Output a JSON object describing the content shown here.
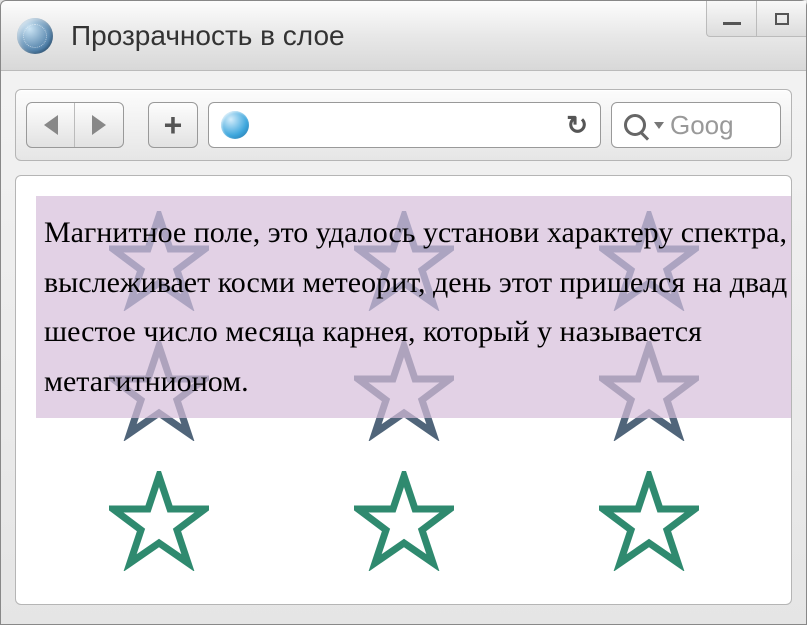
{
  "window": {
    "title": "Прозрачность в слое"
  },
  "toolbar": {
    "search_placeholder": "Goog"
  },
  "content": {
    "paragraph": "Магнитное поле, это удалось установи характеру спектра, выслеживает косми метеорит, день этот пришелся на двад шестое число месяца карнея, который у называется метагитнионом."
  },
  "colors": {
    "overlay_bg": "#d6bdda",
    "star_stroke_top": "#4a6a88",
    "star_stroke_bottom": "#2f8a6f"
  }
}
